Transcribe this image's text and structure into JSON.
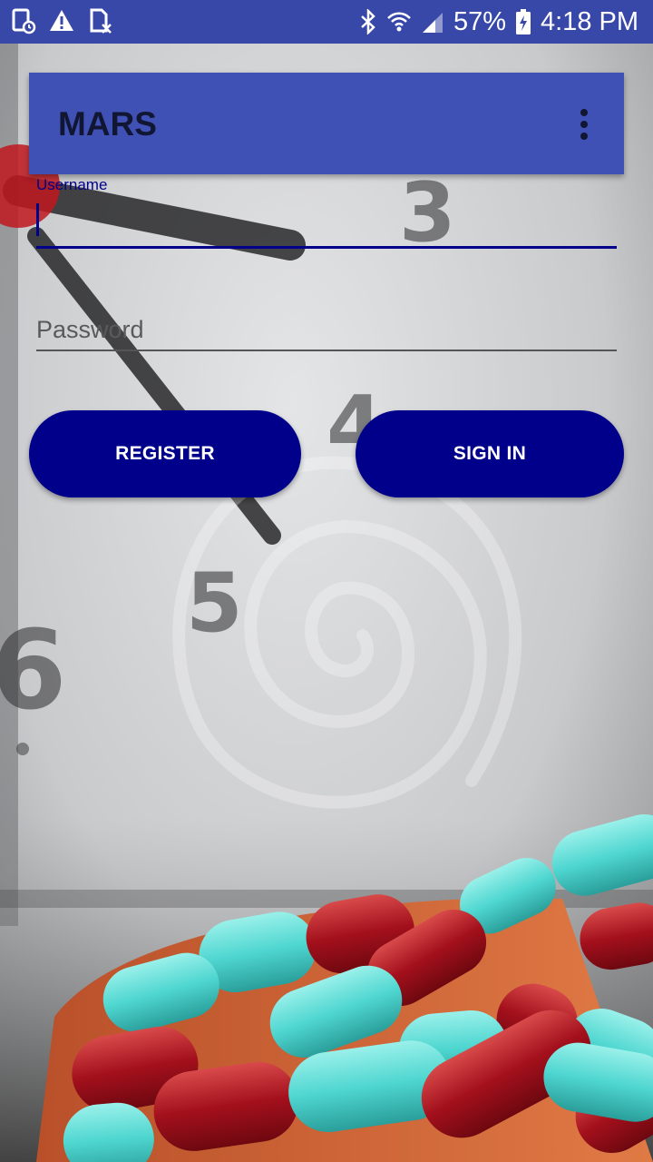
{
  "status_bar": {
    "battery": "57%",
    "time": "4:18 PM",
    "left_icons": [
      "screenshot-icon",
      "warning-icon",
      "sim-off-icon"
    ],
    "right_icons": [
      "bluetooth-icon",
      "wifi-icon",
      "signal-icon",
      "battery-charging-icon"
    ]
  },
  "app_bar": {
    "title": "MARS",
    "menu_icon": "more-vert-icon"
  },
  "login_form": {
    "username_label": "Username",
    "username_value": "",
    "password_placeholder": "Password",
    "password_value": ""
  },
  "buttons": {
    "register_label": "REGISTER",
    "sign_in_label": "SIGN IN"
  },
  "background": {
    "scene": "clock-and-capsules",
    "watermark": "spiral-logo"
  },
  "colors": {
    "status_bar": "#3848a8",
    "app_bar": "#3f51b5",
    "accent": "#00008b",
    "capsule_teal": "#4fd6d0",
    "capsule_red": "#a3101c"
  }
}
